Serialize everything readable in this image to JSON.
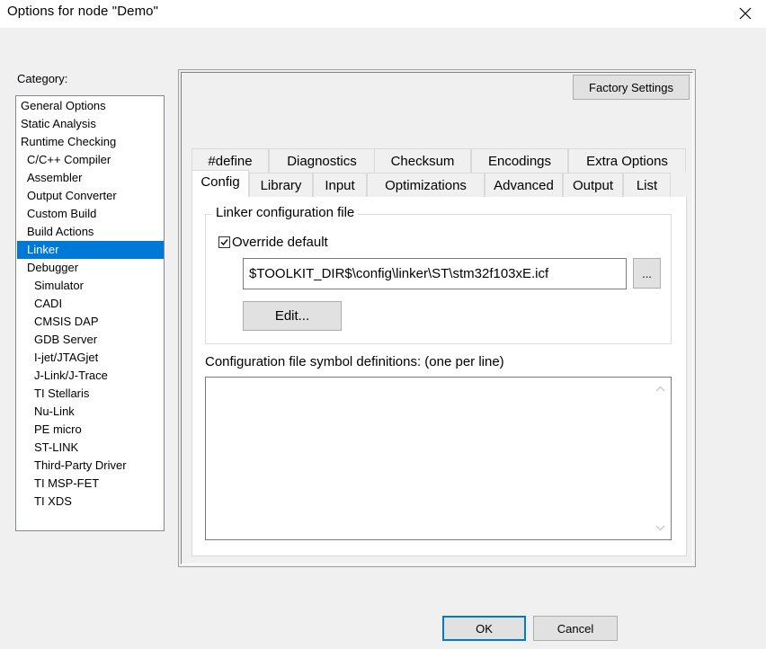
{
  "window": {
    "title": "Options for node \"Demo\"",
    "close_icon": "close-icon"
  },
  "category": {
    "label": "Category:",
    "items": [
      {
        "label": "General Options",
        "indent": 0
      },
      {
        "label": "Static Analysis",
        "indent": 0
      },
      {
        "label": "Runtime Checking",
        "indent": 0
      },
      {
        "label": "C/C++ Compiler",
        "indent": 1
      },
      {
        "label": "Assembler",
        "indent": 1
      },
      {
        "label": "Output Converter",
        "indent": 1
      },
      {
        "label": "Custom Build",
        "indent": 1
      },
      {
        "label": "Build Actions",
        "indent": 1
      },
      {
        "label": "Linker",
        "indent": 1,
        "selected": true
      },
      {
        "label": "Debugger",
        "indent": 1
      },
      {
        "label": "Simulator",
        "indent": 2
      },
      {
        "label": "CADI",
        "indent": 2
      },
      {
        "label": "CMSIS DAP",
        "indent": 2
      },
      {
        "label": "GDB Server",
        "indent": 2
      },
      {
        "label": "I-jet/JTAGjet",
        "indent": 2
      },
      {
        "label": "J-Link/J-Trace",
        "indent": 2
      },
      {
        "label": "TI Stellaris",
        "indent": 2
      },
      {
        "label": "Nu-Link",
        "indent": 2
      },
      {
        "label": "PE micro",
        "indent": 2
      },
      {
        "label": "ST-LINK",
        "indent": 2
      },
      {
        "label": "Third-Party Driver",
        "indent": 2
      },
      {
        "label": "TI MSP-FET",
        "indent": 2
      },
      {
        "label": "TI XDS",
        "indent": 2
      }
    ]
  },
  "factory_settings_label": "Factory Settings",
  "tabs_row1": [
    "#define",
    "Diagnostics",
    "Checksum",
    "Encodings",
    "Extra Options"
  ],
  "tabs_row2": [
    "Config",
    "Library",
    "Input",
    "Optimizations",
    "Advanced",
    "Output",
    "List"
  ],
  "active_tab": "Config",
  "config": {
    "group_title": "Linker configuration file",
    "override_label": "Override default",
    "override_checked": true,
    "file_path": "$TOOLKIT_DIR$\\config\\linker\\ST\\stm32f103xE.icf",
    "browse_label": "...",
    "edit_label": "Edit...",
    "symbols_label": "Configuration file symbol definitions: (one per line)",
    "symbols_value": ""
  },
  "footer": {
    "ok_label": "OK",
    "cancel_label": "Cancel"
  },
  "colors": {
    "selection": "#0078d7",
    "dialog_bg": "#f0f0f0",
    "button_bg": "#e1e1e1"
  }
}
